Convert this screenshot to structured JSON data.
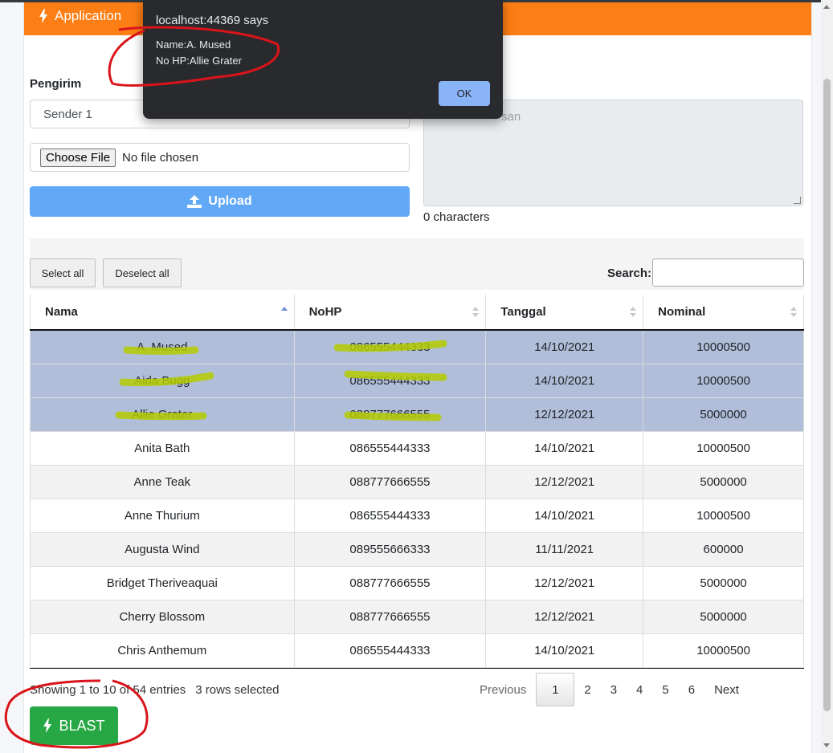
{
  "app": {
    "title": "Application"
  },
  "form": {
    "sender_label": "Pengirim",
    "sender_value": "Sender 1",
    "file_button": "Choose File",
    "file_status": "No file chosen",
    "upload_label": "Upload",
    "message_placeholder_visible": "san",
    "char_count": "0 characters"
  },
  "toolbar": {
    "select_all": "Select all",
    "deselect_all": "Deselect all",
    "search_label": "Search:"
  },
  "table": {
    "columns": [
      "Nama",
      "NoHP",
      "Tanggal",
      "Nominal"
    ],
    "rows": [
      {
        "nama": "A. Mused",
        "nohp": "086555444333",
        "tanggal": "14/10/2021",
        "nominal": "10000500",
        "selected": true
      },
      {
        "nama": "Aida Bugg",
        "nohp": "086555444333",
        "tanggal": "14/10/2021",
        "nominal": "10000500",
        "selected": true
      },
      {
        "nama": "Allie Grater",
        "nohp": "088777666555",
        "tanggal": "12/12/2021",
        "nominal": "5000000",
        "selected": true
      },
      {
        "nama": "Anita Bath",
        "nohp": "086555444333",
        "tanggal": "14/10/2021",
        "nominal": "10000500",
        "selected": false
      },
      {
        "nama": "Anne Teak",
        "nohp": "088777666555",
        "tanggal": "12/12/2021",
        "nominal": "5000000",
        "selected": false
      },
      {
        "nama": "Anne Thurium",
        "nohp": "086555444333",
        "tanggal": "14/10/2021",
        "nominal": "10000500",
        "selected": false
      },
      {
        "nama": "Augusta Wind",
        "nohp": "089555666333",
        "tanggal": "11/11/2021",
        "nominal": "600000",
        "selected": false
      },
      {
        "nama": "Bridget Theriveaquai",
        "nohp": "088777666555",
        "tanggal": "12/12/2021",
        "nominal": "5000000",
        "selected": false
      },
      {
        "nama": "Cherry Blossom",
        "nohp": "088777666555",
        "tanggal": "12/12/2021",
        "nominal": "5000000",
        "selected": false
      },
      {
        "nama": "Chris Anthemum",
        "nohp": "086555444333",
        "tanggal": "14/10/2021",
        "nominal": "10000500",
        "selected": false
      }
    ]
  },
  "footer": {
    "info": "Showing 1 to 10 of 54 entries",
    "selected_info": "3 rows selected",
    "pagination": {
      "previous": "Previous",
      "pages": [
        "1",
        "2",
        "3",
        "4",
        "5",
        "6"
      ],
      "current": "1",
      "next": "Next"
    },
    "blast_label": "BLAST"
  },
  "dialog": {
    "title": "localhost:44369 says",
    "line1": "Name:A. Mused",
    "line2": "No HP:Allie Grater",
    "ok": "OK"
  },
  "colors": {
    "header": "#fd7e14",
    "upload": "#61a9f7",
    "blast": "#28a745",
    "selected_row": "#b0bed9",
    "dialog_bg": "#292a2d",
    "annotation_red": "#d9141a",
    "highlight_yellow": "#b5cc00"
  },
  "icons": {
    "title_icon": "bolt-icon",
    "upload_icon": "upload-icon",
    "blast_icon": "bolt-icon"
  }
}
